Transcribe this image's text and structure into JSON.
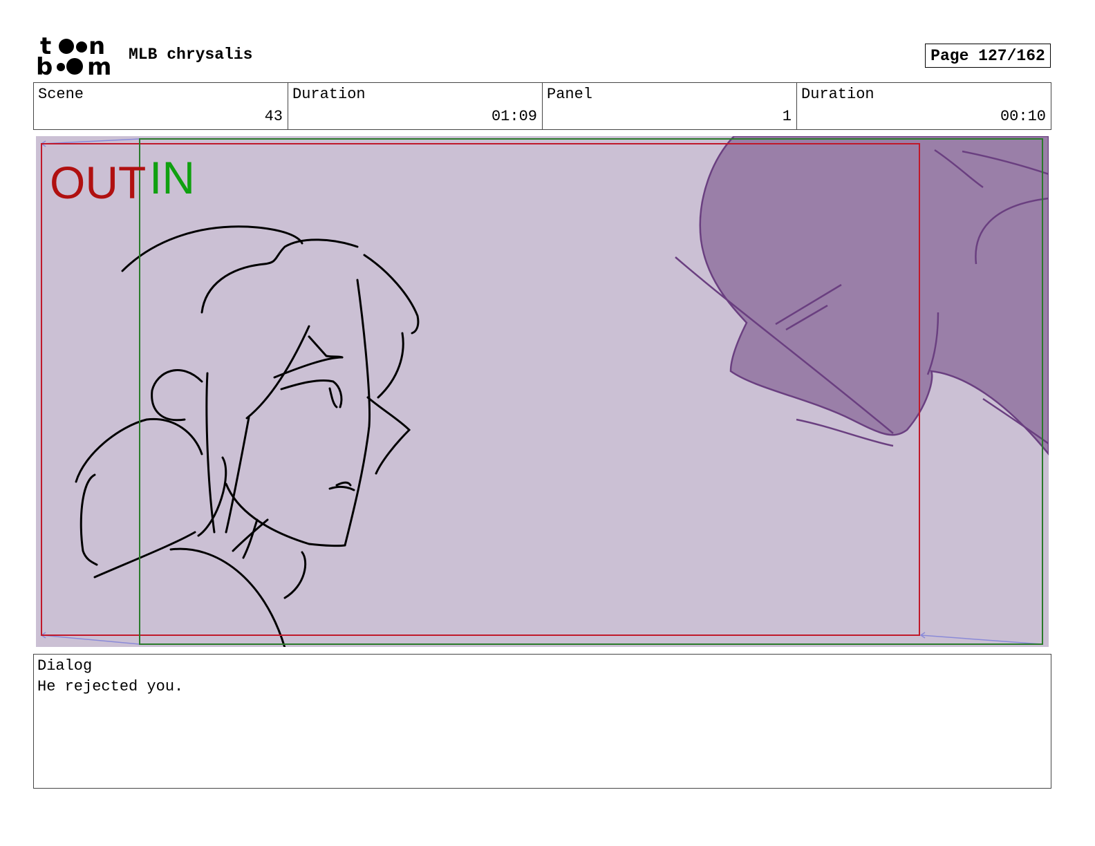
{
  "header": {
    "logo_text": "toon boom",
    "project_title": "MLB chrysalis",
    "page_label": "Page 127/162"
  },
  "info": {
    "scene_label": "Scene",
    "scene_value": "43",
    "scene_duration_label": "Duration",
    "scene_duration_value": "01:09",
    "panel_label": "Panel",
    "panel_value": "1",
    "panel_duration_label": "Duration",
    "panel_duration_value": "00:10"
  },
  "panel": {
    "out_label": "OUT",
    "in_label": "IN",
    "colors": {
      "background": "#cbc0d4",
      "out_frame": "#c0182a",
      "in_frame": "#2a7a2a",
      "out_text": "#b01010",
      "in_text": "#10a010",
      "figure_fill": "#9a7fa8",
      "figure_line": "#6a3f80",
      "sketch_line": "#000000",
      "arrow": "#8a8ad8"
    }
  },
  "dialog": {
    "label": "Dialog",
    "text": "He rejected you."
  }
}
